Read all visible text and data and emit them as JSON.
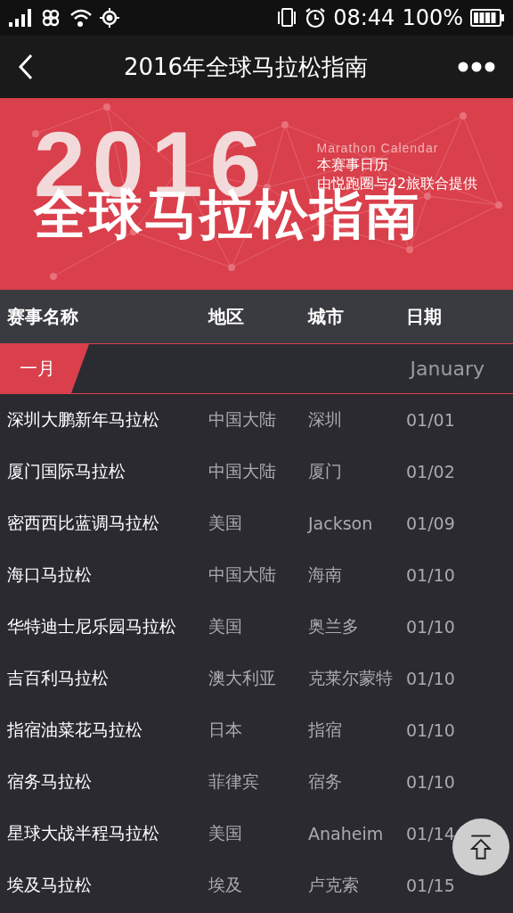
{
  "status_bar": {
    "time": "08:44",
    "battery": "100%"
  },
  "nav": {
    "title": "2016年全球马拉松指南"
  },
  "banner": {
    "year": "2016",
    "subtitle_en": "Marathon Calendar",
    "line_1": "本赛事日历",
    "line_2": "由悦跑圈与42旅联合提供",
    "headline": "全球马拉松指南"
  },
  "table": {
    "columns": [
      "赛事名称",
      "地区",
      "城市",
      "日期"
    ],
    "month": {
      "label": "一月",
      "label_en": "January"
    },
    "rows": [
      {
        "name": "深圳大鹏新年马拉松",
        "region": "中国大陆",
        "city": "深圳",
        "date": "01/01"
      },
      {
        "name": "厦门国际马拉松",
        "region": "中国大陆",
        "city": "厦门",
        "date": "01/02"
      },
      {
        "name": "密西西比蓝调马拉松",
        "region": "美国",
        "city": "Jackson",
        "date": "01/09"
      },
      {
        "name": "海口马拉松",
        "region": "中国大陆",
        "city": "海南",
        "date": "01/10"
      },
      {
        "name": "华特迪士尼乐园马拉松",
        "region": "美国",
        "city": "奥兰多",
        "date": "01/10"
      },
      {
        "name": "吉百利马拉松",
        "region": "澳大利亚",
        "city": "克莱尔蒙特",
        "date": "01/10"
      },
      {
        "name": "指宿油菜花马拉松",
        "region": "日本",
        "city": "指宿",
        "date": "01/10"
      },
      {
        "name": "宿务马拉松",
        "region": "菲律宾",
        "city": "宿务",
        "date": "01/10"
      },
      {
        "name": "星球大战半程马拉松",
        "region": "美国",
        "city": "Anaheim",
        "date": "01/14"
      },
      {
        "name": "埃及马拉松",
        "region": "埃及",
        "city": "卢克索",
        "date": "01/15"
      }
    ]
  }
}
